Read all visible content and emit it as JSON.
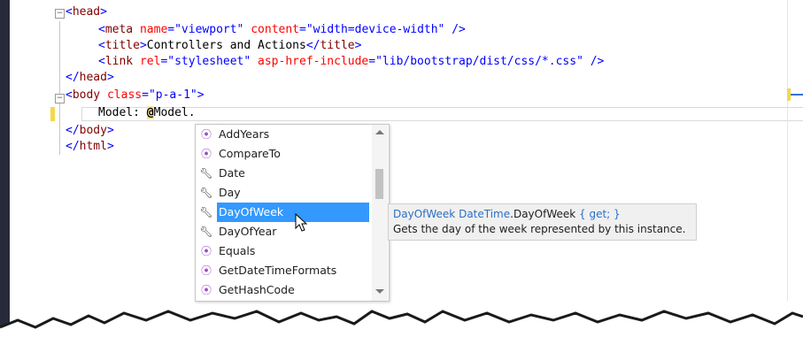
{
  "editor": {
    "lines": {
      "head_open": "head",
      "meta_tag": "meta",
      "meta_attr1": "name",
      "meta_val1": "\"viewport\"",
      "meta_attr2": "content",
      "meta_val2": "\"width=device-width\"",
      "title_tag": "title",
      "title_text": "Controllers and Actions",
      "link_tag": "link",
      "link_attr1": "rel",
      "link_val1": "\"stylesheet\"",
      "link_attr2": "asp-href-include",
      "link_val2": "\"lib/bootstrap/dist/css/*.css\"",
      "head_close": "head",
      "body_tag": "body",
      "body_attr": "class",
      "body_val": "\"p-a-1\"",
      "model_prefix": "Model: ",
      "model_at": "@",
      "model_expr": "Model.",
      "body_close": "body",
      "html_close": "html"
    }
  },
  "completion": {
    "items": [
      {
        "label": "AddYears",
        "icon": "method-icon"
      },
      {
        "label": "CompareTo",
        "icon": "method-icon"
      },
      {
        "label": "Date",
        "icon": "wrench-icon"
      },
      {
        "label": "Day",
        "icon": "wrench-icon"
      },
      {
        "label": "DayOfWeek",
        "icon": "wrench-icon"
      },
      {
        "label": "DayOfYear",
        "icon": "wrench-icon"
      },
      {
        "label": "Equals",
        "icon": "method-icon"
      },
      {
        "label": "GetDateTimeFormats",
        "icon": "method-icon"
      },
      {
        "label": "GetHashCode",
        "icon": "method-icon"
      }
    ],
    "selected_index": 4
  },
  "tooltip": {
    "name": "DayOfWeek",
    "type": "DateTime",
    "member": ".DayOfWeek",
    "accessor": "{ get; }",
    "description": "Gets the day of the week represented by this instance."
  }
}
